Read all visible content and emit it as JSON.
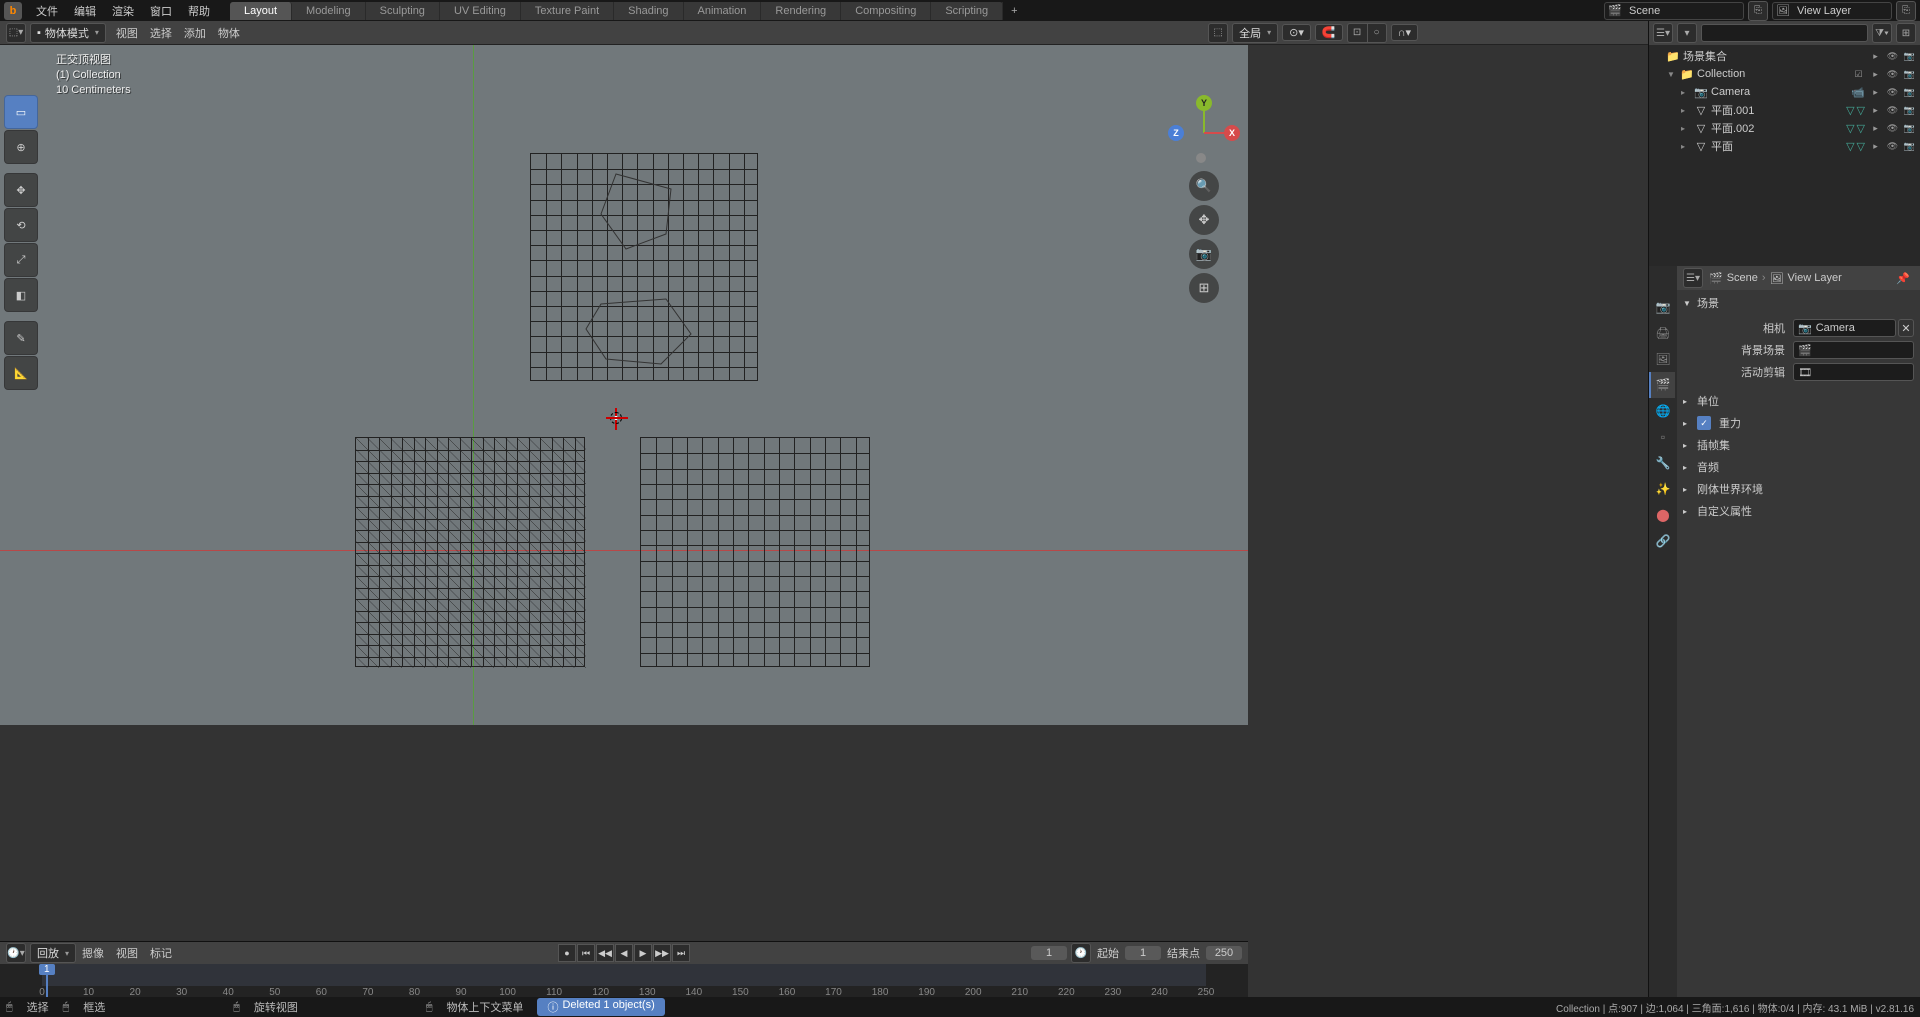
{
  "topmenu": [
    "文件",
    "编辑",
    "渲染",
    "窗口",
    "帮助"
  ],
  "workspaces": [
    "Layout",
    "Modeling",
    "Sculpting",
    "UV Editing",
    "Texture Paint",
    "Shading",
    "Animation",
    "Rendering",
    "Compositing",
    "Scripting"
  ],
  "active_workspace": "Layout",
  "scene_name": "Scene",
  "viewlayer_name": "View Layer",
  "viewheader": {
    "mode": "物体模式",
    "menus": [
      "视图",
      "选择",
      "添加",
      "物体"
    ],
    "orient": "全局"
  },
  "viewlabel": {
    "projection": "正交顶视图",
    "collection": "(1) Collection",
    "scale": "10 Centimeters"
  },
  "outliner": {
    "root": "场景集合",
    "collection": "Collection",
    "items": [
      {
        "name": "Camera",
        "type": "camera"
      },
      {
        "name": "平面.001",
        "type": "mesh"
      },
      {
        "name": "平面.002",
        "type": "mesh"
      },
      {
        "name": "平面",
        "type": "mesh"
      }
    ]
  },
  "props": {
    "bc_scene": "Scene",
    "bc_layer": "View Layer",
    "panel_scene": "场景",
    "camera_lbl": "相机",
    "camera_val": "Camera",
    "bgscene_lbl": "背景场景",
    "clip_lbl": "活动剪辑",
    "collapsed": [
      "单位",
      "重力",
      "插帧集",
      "音频",
      "刚体世界环境",
      "自定义属性"
    ]
  },
  "timeline": {
    "menus": [
      "回放",
      "摁像",
      "视图",
      "标记"
    ],
    "current": 1,
    "start_lbl": "起始",
    "start": 1,
    "end_lbl": "结束点",
    "end": 250,
    "ticks": [
      0,
      10,
      20,
      30,
      40,
      50,
      60,
      70,
      80,
      90,
      100,
      110,
      120,
      130,
      140,
      150,
      160,
      170,
      180,
      190,
      200,
      210,
      220,
      230,
      240,
      250
    ]
  },
  "status": {
    "select": "选择",
    "box": "框选",
    "rotate": "旋转视图",
    "context": "物体上下文菜单",
    "deleted": "Deleted 1 object(s)",
    "info": "Collection | 点:907 | 边:1,064 | 三角面:1,616 | 物体:0/4 | 内存: 43.1 MiB | v2.81.16"
  }
}
